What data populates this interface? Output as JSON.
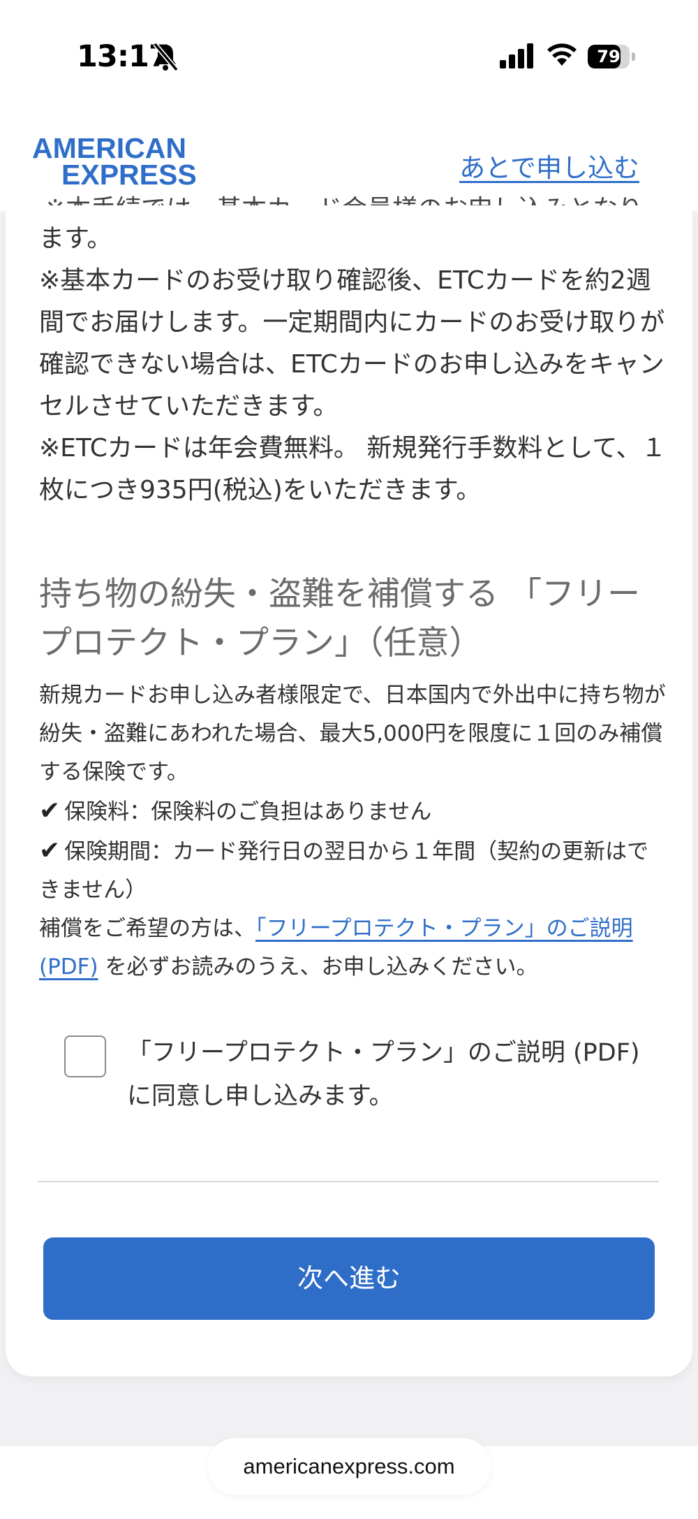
{
  "status_bar": {
    "time": "13:17",
    "battery": "79",
    "battery_level_percent": 79,
    "icons": [
      "bell-slash-icon",
      "cellular-signal-icon",
      "wifi-icon",
      "battery-icon"
    ]
  },
  "header": {
    "logo_line1": "AMERICAN",
    "logo_line2": "EXPRESS",
    "apply_later": "あとで申し込む"
  },
  "etc_notes": {
    "cut_off_line": "※本手続では、基本カード会員様のお申し込みとなり",
    "line0": "ます。",
    "line1": "※基本カードのお受け取り確認後、ETCカードを約2週間でお届けします。一定期間内にカードのお受け取りが確認できない場合は、ETCカードのお申し込みをキャンセルさせていただきます。",
    "line2": "※ETCカードは年会費無料。 新規発行手数料として、１枚につき935円(税込)をいただきます。"
  },
  "free_protect": {
    "title": "持ち物の紛失・盗難を補償する 「フリープロテクト・プラン」（任意）",
    "description": "新規カードお申し込み者様限定で、日本国内で外出中に持ち物が紛失・盗難にあわれた場合、最大5,000円を限度に１回のみ補償する保険です。",
    "check_mark": "✔",
    "premium": "保険料：保険料のご負担はありません",
    "period": "保険期間：カード発行日の翌日から１年間（契約の更新はできません）",
    "read_prefix": "補償をご希望の方は、",
    "pdf_link": "「フリープロテクト・プラン」のご説明(PDF)",
    "read_suffix": "を必ずお読みのうえ、お申し込みください。"
  },
  "agreement": {
    "label": "「フリープロテクト・プラン」のご説明 (PDF) に同意し申し込みます。",
    "checked": false
  },
  "next_button": "次へ進む",
  "browser": {
    "url": "americanexpress.com"
  }
}
